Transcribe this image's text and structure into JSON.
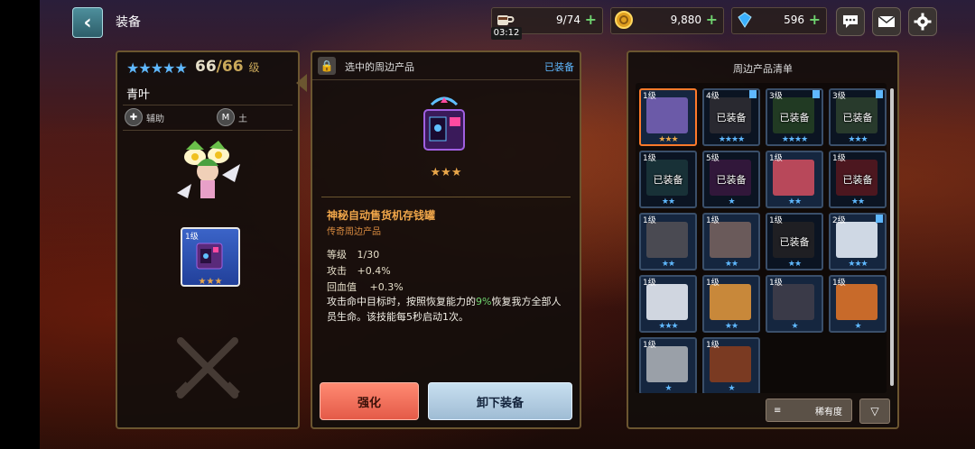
{
  "header": {
    "title": "装备",
    "resources": {
      "coffee": {
        "value": "9/74",
        "timer": "03:12"
      },
      "gold": {
        "value": "9,880"
      },
      "gems": {
        "value": "596"
      }
    }
  },
  "character": {
    "stars": "★★★★★",
    "level": "66",
    "level_max": "/66",
    "level_unit": "级",
    "name": "青叶",
    "role_label": "辅助",
    "element_label": "土",
    "equipped_slot": {
      "level": "1级",
      "stars": "★★★"
    }
  },
  "detail": {
    "header_title": "选中的周边产品",
    "status": "已装备",
    "item_stars": "★★★",
    "item_name": "神秘自动售货机存钱罐",
    "item_type": "传奇周边产品",
    "stats": [
      {
        "key": "等级",
        "value": "1/30"
      },
      {
        "key": "攻击",
        "value": "+0.4%"
      },
      {
        "key": "回血值",
        "value": "+0.3%"
      }
    ],
    "desc_prefix": "攻击命中目标时，按照恢复能力的",
    "desc_highlight": "9%",
    "desc_suffix": "恢复我方全部人员生命。该技能每5秒启动1次。",
    "upgrade_label": "强化",
    "unequip_label": "卸下装备"
  },
  "list": {
    "title": "周边产品清单",
    "equipped_text": "已装备",
    "items": [
      {
        "level": "1级",
        "stars": "★★★",
        "equipped": false,
        "selected": true,
        "color": "#6b5aa8"
      },
      {
        "level": "4级",
        "stars": "★★★★",
        "equipped": true,
        "selected": false,
        "color": "#4b4b58"
      },
      {
        "level": "3级",
        "stars": "★★★★",
        "equipped": true,
        "selected": false,
        "color": "#3c6a40"
      },
      {
        "level": "3级",
        "stars": "★★★",
        "equipped": true,
        "selected": false,
        "color": "#4a6a50"
      },
      {
        "level": "1级",
        "stars": "★★",
        "equipped": true,
        "selected": false,
        "color": "#2c5a64"
      },
      {
        "level": "5级",
        "stars": "★",
        "equipped": true,
        "selected": false,
        "color": "#5a2a6a"
      },
      {
        "level": "1级",
        "stars": "★★",
        "equipped": false,
        "selected": false,
        "color": "#b8485a"
      },
      {
        "level": "1级",
        "stars": "★★",
        "equipped": true,
        "selected": false,
        "color": "#8a2a3a"
      },
      {
        "level": "1级",
        "stars": "★★",
        "equipped": false,
        "selected": false,
        "color": "#4a4a52"
      },
      {
        "level": "1级",
        "stars": "★★",
        "equipped": false,
        "selected": false,
        "color": "#6a5a5a"
      },
      {
        "level": "1级",
        "stars": "★★",
        "equipped": true,
        "selected": false,
        "color": "#3a3a40"
      },
      {
        "level": "2级",
        "stars": "★★★",
        "equipped": false,
        "selected": false,
        "color": "#cfd8e4"
      },
      {
        "level": "1级",
        "stars": "★★★",
        "equipped": false,
        "selected": false,
        "color": "#d0d6e0"
      },
      {
        "level": "1级",
        "stars": "★★",
        "equipped": false,
        "selected": false,
        "color": "#c8883a"
      },
      {
        "level": "1级",
        "stars": "★",
        "equipped": false,
        "selected": false,
        "color": "#3a3a48"
      },
      {
        "level": "1级",
        "stars": "★",
        "equipped": false,
        "selected": false,
        "color": "#c86a2a"
      },
      {
        "level": "1级",
        "stars": "★",
        "equipped": false,
        "selected": false,
        "color": "#9aa0a8"
      },
      {
        "level": "1级",
        "stars": "★",
        "equipped": false,
        "selected": false,
        "color": "#7a3a22"
      }
    ],
    "sort_label": "稀有度"
  }
}
